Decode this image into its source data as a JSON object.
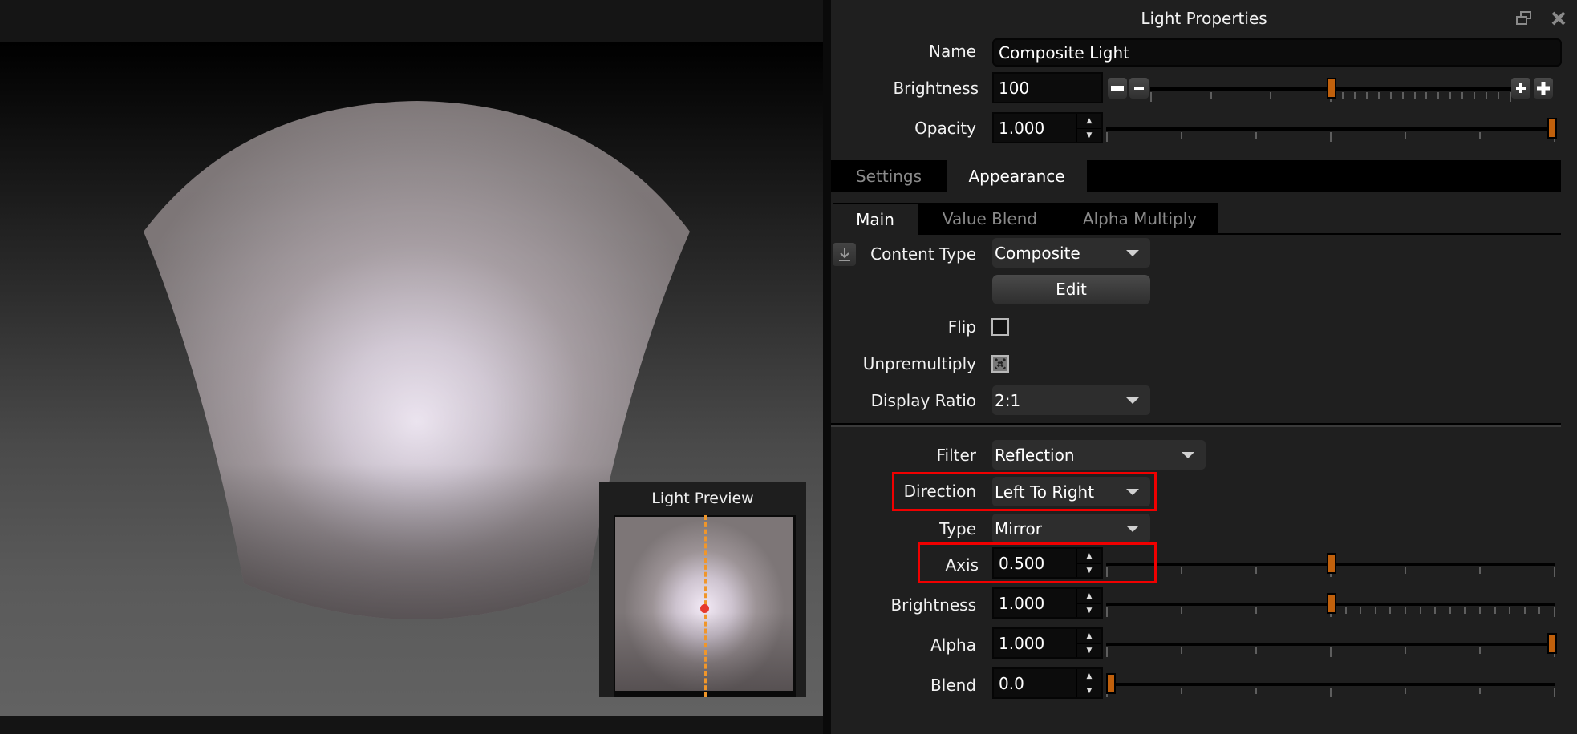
{
  "viewport": {
    "preview": {
      "title": "Light Preview",
      "axis_position": 0.5
    }
  },
  "panel": {
    "title": "Light Properties",
    "window_buttons": {
      "restore": "restore-icon",
      "close": "close-icon"
    },
    "name": {
      "label": "Name",
      "value": "Composite Light"
    },
    "brightness": {
      "label": "Brightness",
      "value": "100",
      "slider": 0.5
    },
    "opacity": {
      "label": "Opacity",
      "value": "1.000",
      "slider": 1.0
    },
    "tabs": [
      {
        "label": "Settings",
        "active": false
      },
      {
        "label": "Appearance",
        "active": true
      }
    ],
    "subtabs": [
      {
        "label": "Main",
        "active": true
      },
      {
        "label": "Value Blend",
        "active": false
      },
      {
        "label": "Alpha Multiply",
        "active": false
      }
    ],
    "content_type": {
      "label": "Content Type",
      "value": "Composite"
    },
    "edit_button": "Edit",
    "flip": {
      "label": "Flip",
      "checked": false
    },
    "unpremultiply": {
      "label": "Unpremultiply",
      "checked": "partial"
    },
    "display_ratio": {
      "label": "Display Ratio",
      "value": "2:1"
    },
    "filter": {
      "label": "Filter",
      "value": "Reflection"
    },
    "direction": {
      "label": "Direction",
      "value": "Left To Right",
      "highlighted": true
    },
    "type": {
      "label": "Type",
      "value": "Mirror"
    },
    "axis": {
      "label": "Axis",
      "value": "0.500",
      "slider": 0.5,
      "highlighted": true
    },
    "brightness2": {
      "label": "Brightness",
      "value": "1.000",
      "slider": 0.5
    },
    "alpha": {
      "label": "Alpha",
      "value": "1.000",
      "slider": 1.0
    },
    "blend": {
      "label": "Blend",
      "value": "0.0",
      "slider": 0.0
    }
  },
  "colors": {
    "accent_handle": "#c0600c",
    "highlight": "#f00000",
    "preview_axis": "#f0962a"
  }
}
